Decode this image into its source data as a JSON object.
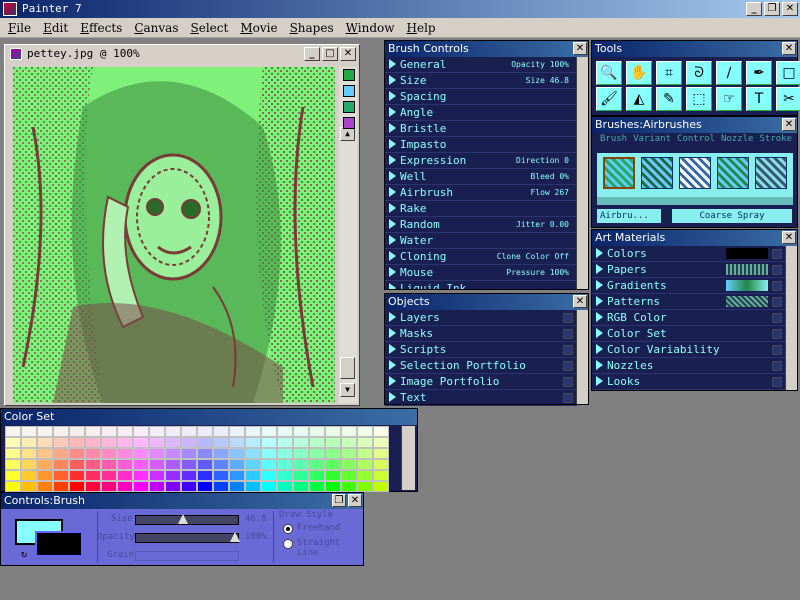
{
  "app": {
    "title": "Painter 7",
    "window_buttons": [
      "_",
      "❐",
      "✕"
    ]
  },
  "menubar": [
    "File",
    "Edit",
    "Effects",
    "Canvas",
    "Select",
    "Movie",
    "Shapes",
    "Window",
    "Help"
  ],
  "document": {
    "title": "pettey.jpg @ 100%",
    "buttons": [
      "_",
      "□",
      "✕"
    ]
  },
  "brush_controls": {
    "title": "Brush Controls",
    "items": [
      {
        "label": "General",
        "value": "Opacity 100%"
      },
      {
        "label": "Size",
        "value": "Size 46.8"
      },
      {
        "label": "Spacing",
        "value": ""
      },
      {
        "label": "Angle",
        "value": ""
      },
      {
        "label": "Bristle",
        "value": ""
      },
      {
        "label": "Impasto",
        "value": ""
      },
      {
        "label": "Expression",
        "value": "Direction 0"
      },
      {
        "label": "Well",
        "value": "Bleed 0%"
      },
      {
        "label": "Airbrush",
        "value": "Flow 267"
      },
      {
        "label": "Rake",
        "value": ""
      },
      {
        "label": "Random",
        "value": "Jitter 0.00"
      },
      {
        "label": "Water",
        "value": ""
      },
      {
        "label": "Cloning",
        "value": "Clone Color Off"
      },
      {
        "label": "Mouse",
        "value": "Pressure 100%"
      },
      {
        "label": "Liquid Ink",
        "value": ""
      }
    ]
  },
  "objects": {
    "title": "Objects",
    "items": [
      "Layers",
      "Masks",
      "Scripts",
      "Selection Portfolio",
      "Image Portfolio",
      "Text"
    ]
  },
  "tools": {
    "title": "Tools",
    "icons": [
      "magnifier-icon",
      "grabber-icon",
      "crop-icon",
      "lasso-icon",
      "brush-icon",
      "pen-icon",
      "rectangle-icon",
      "brush2-icon",
      "paint-bucket-icon",
      "dropper-icon",
      "selection-icon",
      "adjuster-icon",
      "text-icon",
      "scissors-icon"
    ],
    "glyphs": [
      "🔍",
      "✋",
      "⌗",
      "ᘐ",
      "∕",
      "✒",
      "□",
      "🖌",
      "◭",
      "✎",
      "⬚",
      "☞",
      "T",
      "✂"
    ]
  },
  "brushes": {
    "title": "Brushes:Airbrushes",
    "tabs": [
      "Brush",
      "Variant",
      "Control",
      "Nozzle",
      "Stroke"
    ],
    "selected_variant": "Airbru...",
    "stroke_name": "Coarse Spray"
  },
  "art_materials": {
    "title": "Art Materials",
    "items": [
      "Colors",
      "Papers",
      "Gradients",
      "Patterns",
      "RGB Color",
      "Color Set",
      "Color Variability",
      "Nozzles",
      "Looks"
    ]
  },
  "color_set": {
    "title": "Color Set"
  },
  "controls_brush": {
    "title": "Controls:Brush",
    "size_label": "Size",
    "size_value": "46.8",
    "opacity_label": "Opacity",
    "opacity_value": "100%",
    "grain_label": "Grain",
    "draw_style_label": "Draw Style",
    "freehand_label": "Freehand",
    "straight_label": "Straight Line",
    "draw_style_selected": "Freehand",
    "size_slider_fraction": 0.45,
    "opacity_slider_fraction": 1.0
  },
  "colors": {
    "panel_bg": "#1a1f52",
    "text_cyan": "#88ffff",
    "title_blue": "#0a246a",
    "control_purple": "#6a6ad6"
  }
}
